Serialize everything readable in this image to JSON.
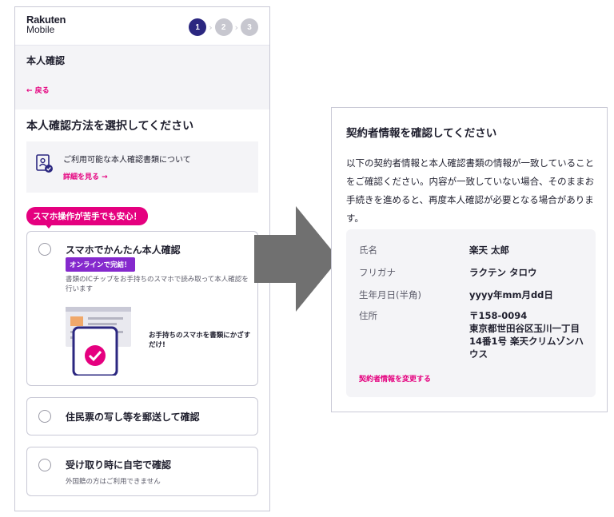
{
  "phone": {
    "logo": {
      "line1": "Rakuten",
      "line2": "Mobile"
    },
    "steps": [
      "1",
      "2",
      "3"
    ],
    "active_step": 1,
    "section_heading": "本人確認",
    "back_label": "← 戻る",
    "page_title": "本人確認方法を選択してください",
    "info": {
      "text": "ご利用可能な本人確認書類について",
      "link": "詳細を見る →"
    },
    "promo_bubble": "スマホ操作が苦手でも安心！",
    "options": [
      {
        "label": "スマホでかんたん本人確認",
        "badge": "オンラインで完結！",
        "description": "書類のICチップをお手持ちのスマホで読み取って本人確認を行います",
        "illustration_caption": "お手持ちのスマホを書類にかざすだけ!"
      },
      {
        "label": "住民票の写し等を郵送して確認"
      },
      {
        "label": "受け取り時に自宅で確認",
        "note": "外国籍の方はご利用できません"
      }
    ]
  },
  "panel": {
    "title": "契約者情報を確認してください",
    "paragraph": "以下の契約者情報と本人確認書類の情報が一致していることをご確認ください。内容が一致していない場合、そのままお手続きを進めると、再度本人確認が必要となる場合があります。",
    "fields": [
      {
        "key": "氏名",
        "value": "楽天 太郎"
      },
      {
        "key": "フリガナ",
        "value": "ラクテン タロウ"
      },
      {
        "key": "生年月日(半角)",
        "value": "yyyy年mm月dd日"
      },
      {
        "key": "住所",
        "value": "〒158-0094\n東京都世田谷区玉川一丁目14番1号 楽天クリムゾンハウス"
      }
    ],
    "change_link": "契約者情報を変更する"
  },
  "colors": {
    "brand_pink": "#e5007f",
    "step_active": "#2b2780",
    "badge_purple": "#8529cd",
    "arrow_gray": "#707070"
  }
}
